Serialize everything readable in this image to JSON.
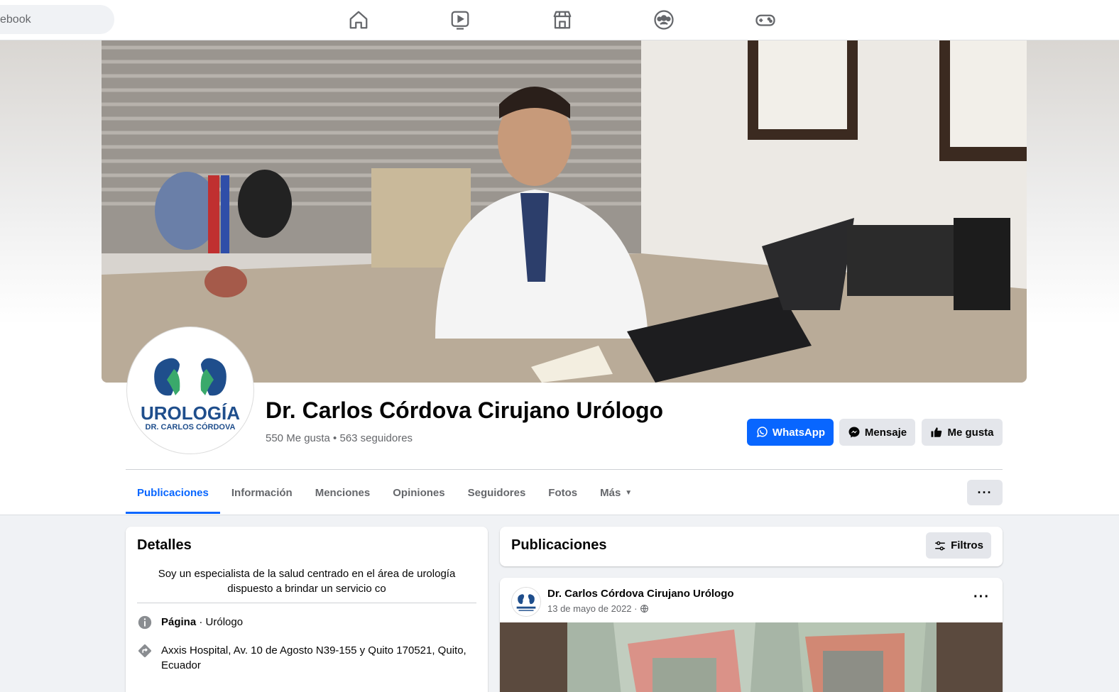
{
  "topbar": {
    "search_placeholder": "ebook",
    "nav_icons": [
      "home-icon",
      "video-icon",
      "marketplace-icon",
      "groups-icon",
      "gaming-icon"
    ]
  },
  "page": {
    "title": "Dr. Carlos Córdova Cirujano Urólogo",
    "stats": "550 Me gusta • 563 seguidores",
    "logo_text_main": "UROLOGÍA",
    "logo_text_sub": "DR. CARLOS CÓRDOVA"
  },
  "actions": {
    "whatsapp": "WhatsApp",
    "message": "Mensaje",
    "like": "Me gusta"
  },
  "tabs": [
    {
      "label": "Publicaciones",
      "active": true
    },
    {
      "label": "Información"
    },
    {
      "label": "Menciones"
    },
    {
      "label": "Opiniones"
    },
    {
      "label": "Seguidores"
    },
    {
      "label": "Fotos"
    },
    {
      "label": "Más"
    }
  ],
  "more_button": "···",
  "details": {
    "title": "Detalles",
    "bio": "Soy un especialista de la salud centrado en el área de urología dispuesto a brindar un servicio co",
    "category_prefix": "Página",
    "category": " · Urólogo",
    "address": "Axxis Hospital, Av. 10 de Agosto N39-155 y Quito 170521, Quito, Ecuador"
  },
  "posts": {
    "title": "Publicaciones",
    "filter_label": "Filtros",
    "items": [
      {
        "author": "Dr. Carlos Córdova Cirujano Urólogo",
        "date": "13 de mayo de 2022 ·",
        "menu": "···"
      }
    ]
  },
  "colors": {
    "accent": "#0866ff",
    "secondary_button": "#e4e6eb",
    "background": "#f0f2f5",
    "muted_text": "#65676b",
    "logo_blue": "#1f4e8c",
    "logo_green": "#3aa96b"
  }
}
